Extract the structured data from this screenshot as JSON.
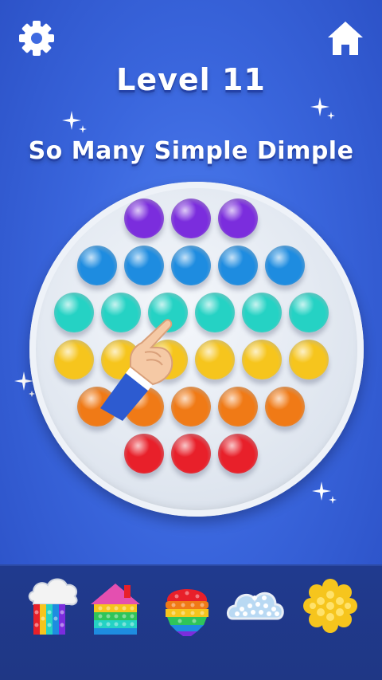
{
  "header": {
    "level": "Level 11",
    "subtitle": "So Many Simple Dimple",
    "settings_icon": "gear-icon",
    "home_icon": "home-icon"
  },
  "board": {
    "rows": [
      {
        "color": "purple",
        "hex": "#7b2ddd",
        "count": 3
      },
      {
        "color": "blue",
        "hex": "#1e8ce0",
        "count": 5
      },
      {
        "color": "cyan",
        "hex": "#25d2c4",
        "count": 6
      },
      {
        "color": "yellow",
        "hex": "#f6c51d",
        "count": 6
      },
      {
        "color": "orange",
        "hex": "#f07a16",
        "count": 5
      },
      {
        "color": "red",
        "hex": "#e8202a",
        "count": 3
      }
    ],
    "hint": "pointing-hand-icon"
  },
  "shape_tray": {
    "items": [
      {
        "name": "rainbow-cloud-popit"
      },
      {
        "name": "house-popit"
      },
      {
        "name": "ice-cream-popit"
      },
      {
        "name": "cloud-popit"
      },
      {
        "name": "flower-popit"
      }
    ]
  },
  "colors": {
    "background": "#3a66dd",
    "tray": "#203a8e"
  }
}
